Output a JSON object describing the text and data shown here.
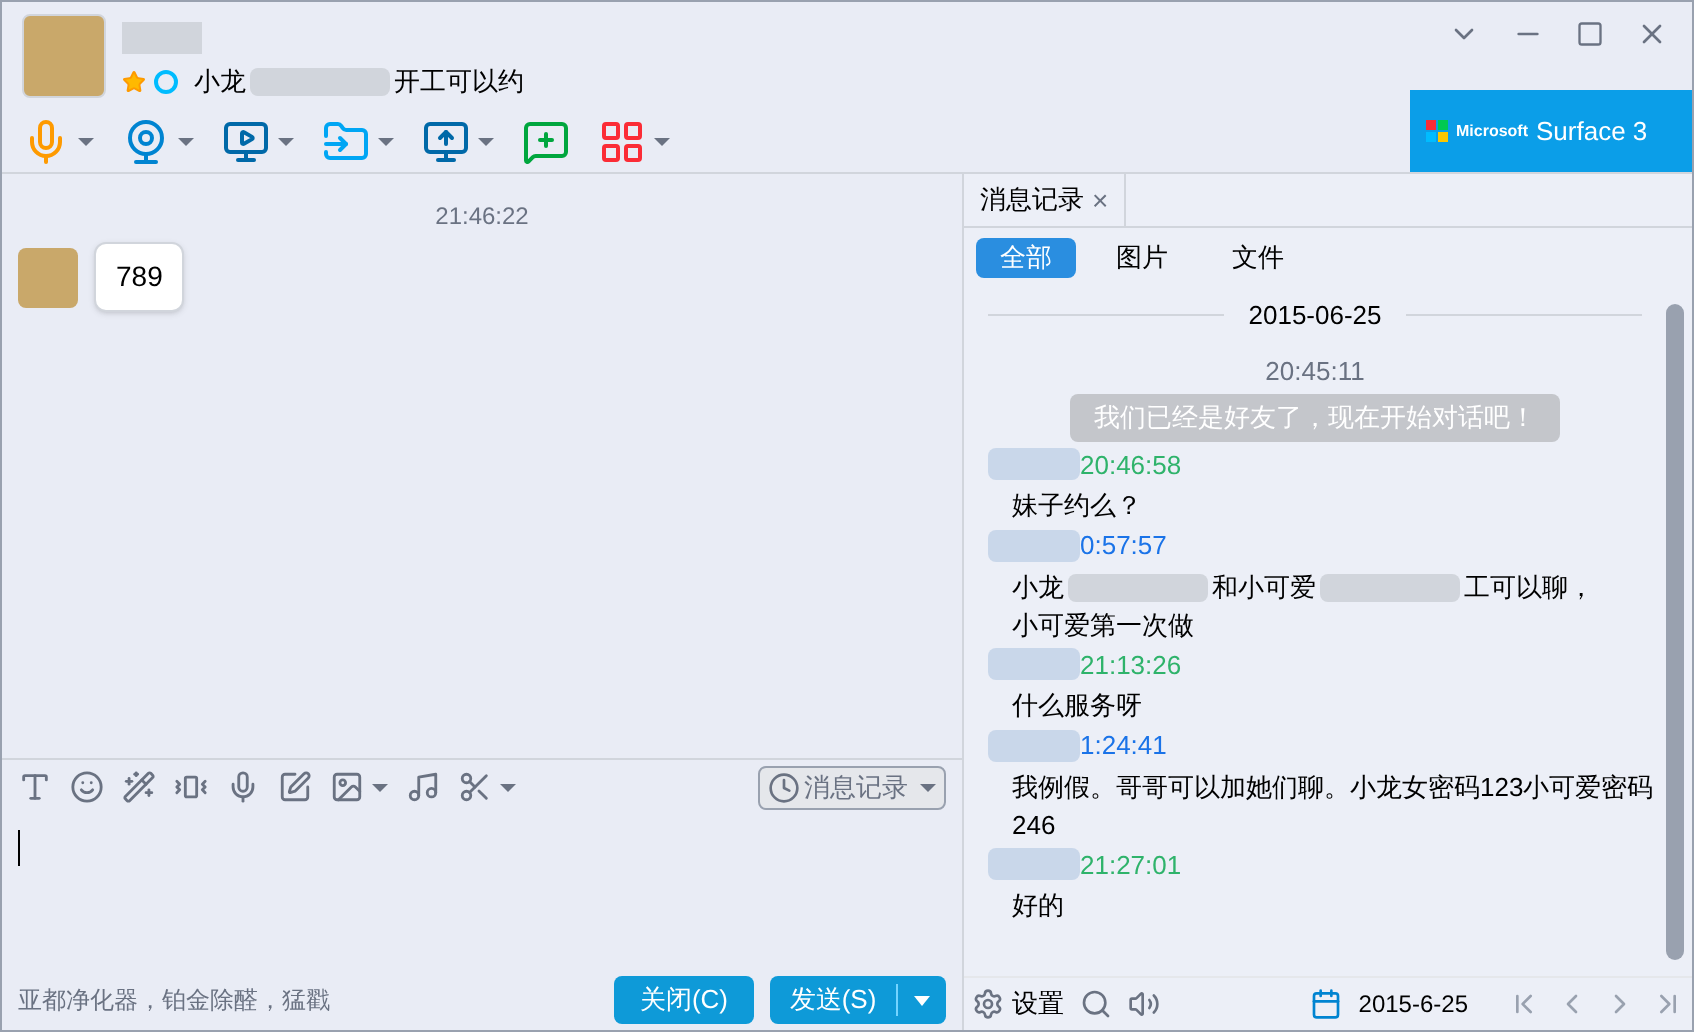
{
  "header": {
    "status_parts": [
      {
        "kind": "text",
        "text": "小龙"
      },
      {
        "kind": "redacted"
      },
      {
        "kind": "text",
        "text": "开工可以约"
      }
    ]
  },
  "ad": {
    "brand": "Microsoft",
    "product": "Surface 3"
  },
  "chat": {
    "time": "21:46:22",
    "messages": [
      {
        "text": "789"
      }
    ]
  },
  "input_toolbar": {
    "history_button": "消息记录"
  },
  "footer": {
    "ad_text": "亚都净化器，铂金除醛，猛戳",
    "close_button": "关闭(C)",
    "send_button": "发送(S)"
  },
  "history": {
    "tab": "消息记录",
    "tab_close": "×",
    "filters": [
      {
        "label": "全部",
        "selected": true
      },
      {
        "label": "图片",
        "selected": false
      },
      {
        "label": "文件",
        "selected": false
      }
    ],
    "date": "2015-06-25",
    "entries": [
      {
        "kind": "system",
        "time": "20:45:11",
        "text": "我们已经是好友了，现在开始对话吧！"
      },
      {
        "kind": "message",
        "time": "20:46:58",
        "color": "#2fb36b",
        "lines": [
          [
            {
              "kind": "text",
              "text": "妹子约么？"
            }
          ]
        ]
      },
      {
        "kind": "message",
        "time": "0:57:57",
        "color": "#1a73e8",
        "lines": [
          [
            {
              "kind": "text",
              "text": "小龙"
            },
            {
              "kind": "redacted"
            },
            {
              "kind": "text",
              "text": "和小可爱"
            },
            {
              "kind": "redacted"
            },
            {
              "kind": "text",
              "text": "工可以聊，"
            }
          ],
          [
            {
              "kind": "text",
              "text": "小可爱第一次做"
            }
          ]
        ]
      },
      {
        "kind": "message",
        "time": "21:13:26",
        "color": "#2fb36b",
        "lines": [
          [
            {
              "kind": "text",
              "text": "什么服务呀"
            }
          ]
        ]
      },
      {
        "kind": "message",
        "time": "1:24:41",
        "color": "#1a73e8",
        "lines": [
          [
            {
              "kind": "text",
              "text": "我例假。哥哥可以加她们聊。小龙女密码123小可爱密码"
            }
          ],
          [
            {
              "kind": "text",
              "text": "246"
            }
          ]
        ]
      },
      {
        "kind": "message",
        "time": "21:27:01",
        "color": "#2fb36b",
        "lines": [
          [
            {
              "kind": "text",
              "text": "好的"
            }
          ]
        ]
      }
    ],
    "settings": "设置",
    "calendar_date": "2015-6-25"
  }
}
